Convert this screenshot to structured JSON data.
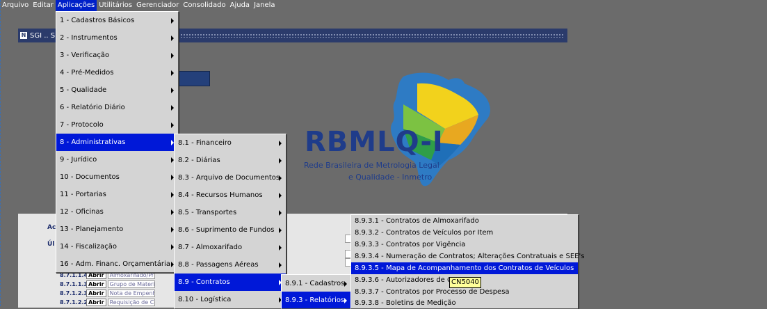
{
  "menubar": [
    "Arquivo",
    "Editar",
    "Aplicações",
    "Utilitários",
    "Gerenciador",
    "Consolidado",
    "Ajuda",
    "Janela"
  ],
  "window": {
    "title": "SGI .. S"
  },
  "logo": {
    "name": "RBMLQ-I",
    "subtitle1": "Rede Brasileira de Metrologia Legal",
    "subtitle2": "e Qualidade - Inmetro"
  },
  "labels": {
    "ac": "Ac",
    "ul": "Úl"
  },
  "rows": [
    {
      "code": "8.7.1.1.4",
      "button": "Abrir",
      "value": "Almoxarifado/Prateleira"
    },
    {
      "code": "8.7.1.1.3",
      "button": "Abrir",
      "value": "Grupo de Material"
    },
    {
      "code": "8.7.1.2.3",
      "button": "Abrir",
      "value": "Nota de Empenho"
    },
    {
      "code": "8.7.1.2.2",
      "button": "Abrir",
      "value": "Requisição de Compra"
    }
  ],
  "menu_aplicacoes": [
    "1 - Cadastros Básicos",
    "2 - Instrumentos",
    "3 - Verificação",
    "4 - Pré-Medidos",
    "5 - Qualidade",
    "6 - Relatório Diário",
    "7 - Protocolo",
    "8 - Administrativas",
    "9 - Jurídico",
    "10 - Documentos",
    "11 - Portarias",
    "12 - Oficinas",
    "13 - Planejamento",
    "14 - Fiscalização",
    "16 - Adm. Financ. Orçamentária"
  ],
  "menu_administrativas": [
    "8.1 - Financeiro",
    "8.2 - Diárias",
    "8.3 - Arquivo de Documentos",
    "8.4 - Recursos Humanos",
    "8.5 - Transportes",
    "8.6 - Suprimento de Fundos",
    "8.7 - Almoxarifado",
    "8.8 - Passagens Aéreas",
    "8.9 - Contratos",
    "8.10 - Logística"
  ],
  "menu_contratos": [
    "8.9.1 - Cadastros",
    "8.9.3 - Relatórios"
  ],
  "menu_relatorios": [
    "8.9.3.1 - Contratos de Almoxarifado",
    "8.9.3.2 - Contratos de Veículos por Item",
    "8.9.3.3 - Contratos por Vigência",
    "8.9.3.4 - Numeração de Contratos; Alterações Contratuais e SEE's",
    "8.9.3.5 - Mapa de Acompanhamento dos Contratos de Veículos",
    "8.9.3.6 - Autorizadores de Co",
    "8.9.3.7 - Contratos por Processo de Despesa",
    "8.9.3.8 - Boletins de Medição"
  ],
  "tooltip": "CN5040",
  "colors": {
    "selection": "#0018d8",
    "menu_bg": "#d4d4d4",
    "desktop": "#6b6b6b",
    "title_bar": "#2b3b6b",
    "tooltip_bg": "#ffff9a"
  }
}
